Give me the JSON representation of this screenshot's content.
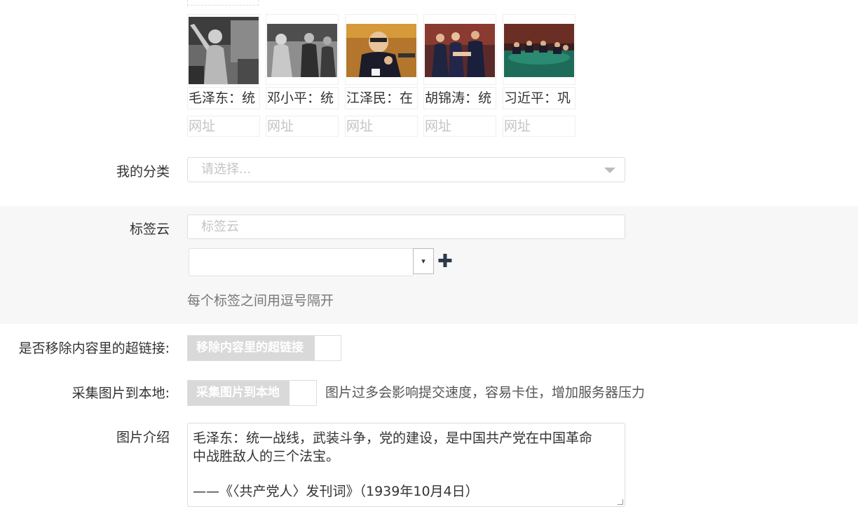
{
  "thumbnails": [
    {
      "title": "毛泽东：统",
      "url_placeholder": "网址"
    },
    {
      "title": "邓小平：统",
      "url_placeholder": "网址"
    },
    {
      "title": "江泽民：在",
      "url_placeholder": "网址"
    },
    {
      "title": "胡锦涛：统",
      "url_placeholder": "网址"
    },
    {
      "title": "习近平：巩",
      "url_placeholder": "网址"
    }
  ],
  "category": {
    "label": "我的分类",
    "placeholder": "请选择..."
  },
  "tags": {
    "label": "标签云",
    "placeholder": "标签云",
    "hint": "每个标签之间用逗号隔开",
    "combo_arrow": "▾",
    "add_symbol": "✚"
  },
  "remove_links": {
    "label": "是否移除内容里的超链接:",
    "toggle_text": "移除内容里的超链接"
  },
  "collect_images": {
    "label": "采集图片到本地:",
    "toggle_text": "采集图片到本地",
    "note": "图片过多会影响提交速度，容易卡住，增加服务器压力"
  },
  "description": {
    "label": "图片介绍",
    "lines": [
      "毛泽东：统一战线，武装斗争，党的建设，是中国共产党在中国革命",
      "中战胜敌人的三个法宝。",
      "",
      "——《〈共产党人〉发刊词》（1939年10月4日）"
    ]
  }
}
